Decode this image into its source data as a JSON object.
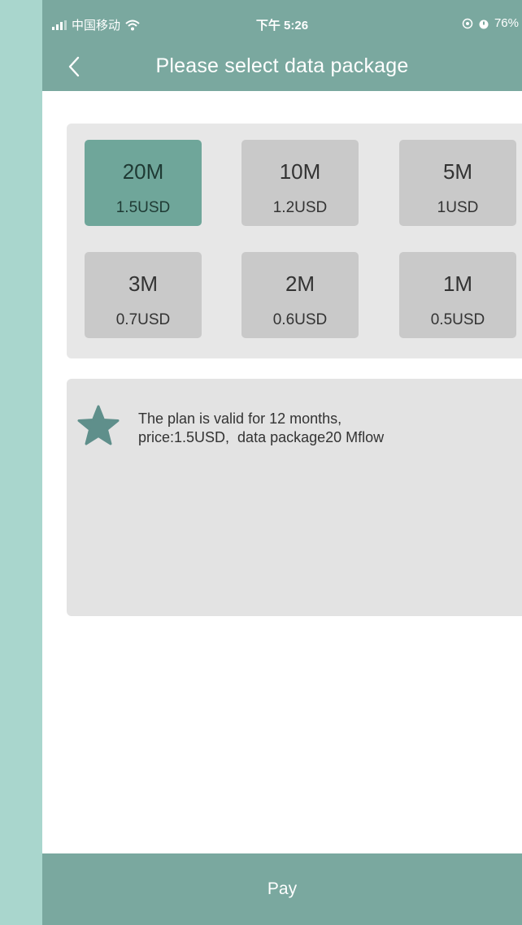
{
  "status_bar": {
    "carrier": "中国移动",
    "time": "下午 5:26",
    "battery": "76%"
  },
  "nav": {
    "back_icon": "chevron-left-icon",
    "title": "Please select data package"
  },
  "packages": [
    {
      "size": "20M",
      "price": "1.5USD",
      "selected": true
    },
    {
      "size": "10M",
      "price": "1.2USD",
      "selected": false
    },
    {
      "size": "5M",
      "price": "1USD",
      "selected": false
    },
    {
      "size": "3M",
      "price": "0.7USD",
      "selected": false
    },
    {
      "size": "2M",
      "price": "0.6USD",
      "selected": false
    },
    {
      "size": "1M",
      "price": "0.5USD",
      "selected": false
    }
  ],
  "info": {
    "icon": "star-icon",
    "line1": "The plan is valid for 12 months,",
    "line2": "price:1.5USD,  data package20 Mflow"
  },
  "pay_label": "Pay",
  "colors": {
    "accent": "#7aa89f",
    "selected": "#6fa69a",
    "unselected": "#c9c9c9",
    "star": "#5f8f8b"
  }
}
